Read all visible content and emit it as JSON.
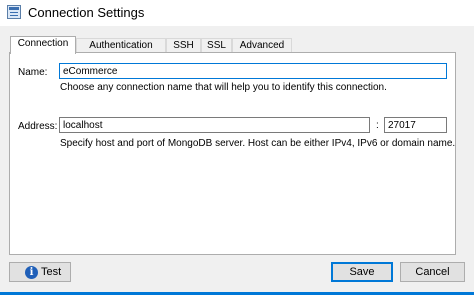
{
  "window": {
    "title": "Connection Settings",
    "icon": "app-window-icon"
  },
  "tabs": [
    {
      "label": "Connection",
      "active": true
    },
    {
      "label": "Authentication",
      "active": false
    },
    {
      "label": "SSH",
      "active": false
    },
    {
      "label": "SSL",
      "active": false
    },
    {
      "label": "Advanced",
      "active": false
    }
  ],
  "connection": {
    "name_label": "Name:",
    "name_value": "eCommerce",
    "name_hint": "Choose any connection name that will help you to identify this connection.",
    "address_label": "Address:",
    "host_value": "localhost",
    "separator": ":",
    "port_value": "27017",
    "address_hint": "Specify host and port of MongoDB server. Host can be either IPv4, IPv6 or domain name."
  },
  "buttons": {
    "test_label": "Test",
    "test_icon": "info-icon",
    "save_label": "Save",
    "cancel_label": "Cancel"
  },
  "colors": {
    "accent": "#0078d7",
    "dialog_bg": "#f0f0f0"
  }
}
